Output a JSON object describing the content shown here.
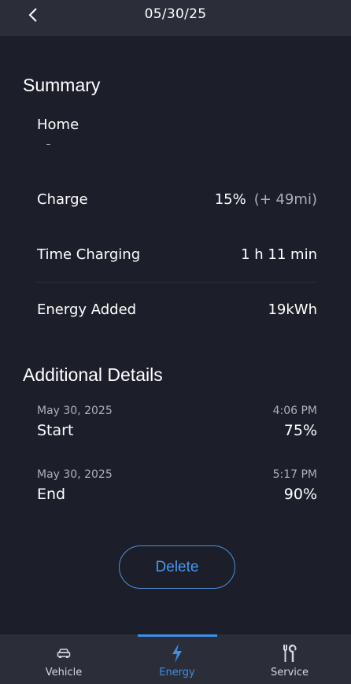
{
  "header": {
    "date": "05/30/25"
  },
  "summary": {
    "title": "Summary",
    "location": "Home",
    "charge": {
      "label": "Charge",
      "value": "15%",
      "extra": "(+ 49mi)"
    },
    "time_charging": {
      "label": "Time Charging",
      "value": "1 h 11 min"
    },
    "energy_added": {
      "label": "Energy Added",
      "value": "19kWh"
    }
  },
  "additional": {
    "title": "Additional Details",
    "start": {
      "date": "May 30, 2025",
      "time": "4:06 PM",
      "label": "Start",
      "value": "75%"
    },
    "end": {
      "date": "May 30, 2025",
      "time": "5:17 PM",
      "label": "End",
      "value": "90%"
    }
  },
  "actions": {
    "delete_label": "Delete"
  },
  "tabs": {
    "vehicle": {
      "label": "Vehicle",
      "icon": "car-icon"
    },
    "energy": {
      "label": "Energy",
      "icon": "lightning-icon",
      "active": true
    },
    "service": {
      "label": "Service",
      "icon": "tools-icon"
    }
  },
  "colors": {
    "accent": "#3d8fe8",
    "background": "#1c1f2a",
    "bar": "#2b2e39"
  }
}
